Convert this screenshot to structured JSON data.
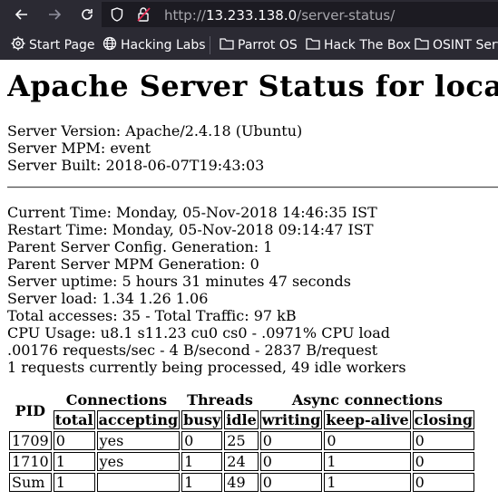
{
  "browser": {
    "url_prefix": "http://",
    "url_host": "13.233.138.0",
    "url_path": "/server-status/",
    "bookmarks": [
      {
        "label": "Start Page",
        "icon": "gear-icon"
      },
      {
        "label": "Hacking Labs",
        "icon": "globe-icon"
      },
      {
        "label": "Parrot OS",
        "icon": "folder-icon"
      },
      {
        "label": "Hack The Box",
        "icon": "folder-icon"
      },
      {
        "label": "OSINT Serv",
        "icon": "folder-icon"
      }
    ]
  },
  "page": {
    "title": "Apache Server Status for local",
    "server_version": "Server Version: Apache/2.4.18 (Ubuntu)",
    "server_mpm": "Server MPM: event",
    "server_built": "Server Built: 2018-06-07T19:43:03",
    "current_time": "Current Time: Monday, 05-Nov-2018 14:46:35 IST",
    "restart_time": "Restart Time: Monday, 05-Nov-2018 09:14:47 IST",
    "config_generation": "Parent Server Config. Generation: 1",
    "mpm_generation": "Parent Server MPM Generation: 0",
    "uptime": "Server uptime: 5 hours 31 minutes 47 seconds",
    "load": "Server load: 1.34 1.26 1.06",
    "accesses": "Total accesses: 35 - Total Traffic: 97 kB",
    "cpu": "CPU Usage: u8.1 s11.23 cu0 cs0 - .0971% CPU load",
    "rates": ".00176 requests/sec - 4 B/second - 2837 B/request",
    "workers": "1 requests currently being processed, 49 idle workers"
  },
  "table": {
    "group_headers": {
      "pid": "PID",
      "connections": "Connections",
      "threads": "Threads",
      "async": "Async connections"
    },
    "columns": [
      "total",
      "accepting",
      "busy",
      "idle",
      "writing",
      "keep-alive",
      "closing"
    ],
    "rows": [
      [
        "1709",
        "0",
        "yes",
        "0",
        "25",
        "0",
        "0",
        "0"
      ],
      [
        "1710",
        "1",
        "yes",
        "1",
        "24",
        "0",
        "1",
        "0"
      ],
      [
        "Sum",
        "1",
        "",
        "1",
        "49",
        "0",
        "1",
        "0"
      ]
    ]
  }
}
